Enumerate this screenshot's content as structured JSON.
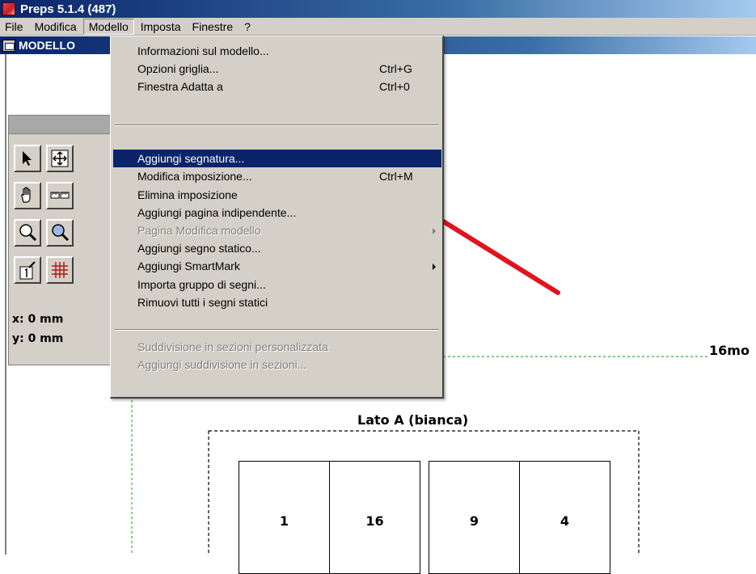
{
  "window": {
    "title": "Preps 5.1.4 (487)"
  },
  "menubar": {
    "items": [
      {
        "label": "File",
        "name": "menu-file",
        "active": false
      },
      {
        "label": "Modifica",
        "name": "menu-modifica",
        "active": false
      },
      {
        "label": "Modello",
        "name": "menu-modello",
        "active": true
      },
      {
        "label": "Imposta",
        "name": "menu-imposta",
        "active": false
      },
      {
        "label": "Finestre",
        "name": "menu-finestre",
        "active": false
      },
      {
        "label": "?",
        "name": "menu-help",
        "active": false
      }
    ]
  },
  "document": {
    "title": "MODELLO"
  },
  "palette": {
    "x_readout": "x: 0 mm",
    "y_readout": "y: 0 mm",
    "tools": [
      "pointer-icon",
      "move-icon",
      "hand-icon",
      "ruler-icon",
      "zoom-in-icon",
      "zoom-out-icon",
      "page-number-icon",
      "grid-icon"
    ]
  },
  "dropdown": {
    "items": [
      {
        "label": "Informazioni sul modello...",
        "shortcut": "",
        "state": "normal",
        "submenu": false
      },
      {
        "label": "Opzioni griglia...",
        "shortcut": "Ctrl+G",
        "state": "normal",
        "submenu": false
      },
      {
        "label": "Finestra Adatta a",
        "shortcut": "Ctrl+0",
        "state": "normal",
        "submenu": false
      },
      {
        "label": "Aggiungi segnatura...",
        "shortcut": "",
        "state": "selected",
        "submenu": false
      },
      {
        "label": "Modifica imposizione...",
        "shortcut": "Ctrl+M",
        "state": "normal",
        "submenu": false
      },
      {
        "label": "Elimina imposizione",
        "shortcut": "",
        "state": "normal",
        "submenu": false
      },
      {
        "label": "Aggiungi pagina indipendente...",
        "shortcut": "",
        "state": "normal",
        "submenu": false
      },
      {
        "label": "Pagina Modifica modello",
        "shortcut": "",
        "state": "disabled",
        "submenu": true
      },
      {
        "label": "Aggiungi segno statico...",
        "shortcut": "",
        "state": "normal",
        "submenu": false
      },
      {
        "label": "Aggiungi SmartMark",
        "shortcut": "",
        "state": "normal",
        "submenu": true
      },
      {
        "label": "Importa gruppo di segni...",
        "shortcut": "",
        "state": "normal",
        "submenu": false
      },
      {
        "label": "Rimuovi tutti i segni statici",
        "shortcut": "",
        "state": "normal",
        "submenu": false
      },
      {
        "label": "Suddivisione in sezioni personalizzata",
        "shortcut": "",
        "state": "disabled",
        "submenu": false
      },
      {
        "label": "Aggiungi suddivisione in sezioni...",
        "shortcut": "",
        "state": "disabled",
        "submenu": false
      }
    ]
  },
  "canvas": {
    "signature_label": "16mo",
    "side_label": "Lato A (bianca)",
    "pages": [
      "1",
      "16",
      "9",
      "4"
    ]
  },
  "colors": {
    "titlebar": "#0a246a",
    "menu_highlight": "#0a246a",
    "annotation_arrow": "#e0141e",
    "guide_line": "#2fb52f"
  }
}
